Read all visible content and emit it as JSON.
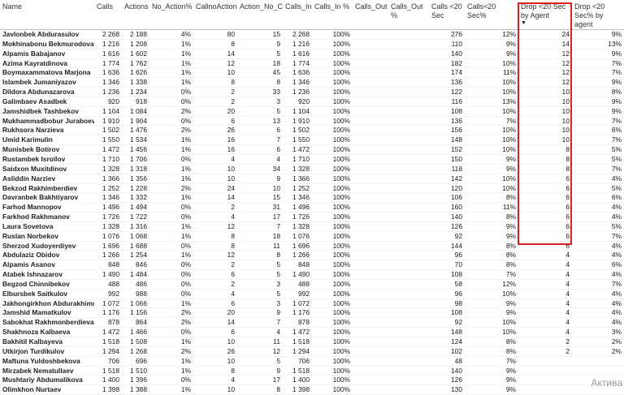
{
  "columns": [
    "Name",
    "Calls",
    "Actions",
    "No_Action%",
    "CallnoAction",
    "Action_No_Call",
    "Calls_In",
    "Calls_In %",
    "Calls_Out",
    "Calls_Out %",
    "Calls <20 Sec",
    "Calls<20 Sec%",
    "Drop <20 Sec by Agent",
    "Drop <20 Sec% by agent"
  ],
  "sort_indicator": "▼",
  "watermark": "Актива",
  "colors": {
    "highlight": "#e02020"
  },
  "rows": [
    [
      "Javlonbek Abdurasulov",
      "2 268",
      "2 188",
      "4%",
      "80",
      "15",
      "2 268",
      "100%",
      "",
      "",
      "276",
      "12%",
      "24",
      "9%"
    ],
    [
      "Mokhinabonu Bekmurodova",
      "1 216",
      "1 208",
      "1%",
      "8",
      "9",
      "1 216",
      "100%",
      "",
      "",
      "110",
      "9%",
      "14",
      "13%"
    ],
    [
      "Alpamis Babajanov",
      "1 616",
      "1 602",
      "1%",
      "14",
      "5",
      "1 616",
      "100%",
      "",
      "",
      "140",
      "9%",
      "12",
      "9%"
    ],
    [
      "Azima Kayratdinova",
      "1 774",
      "1 762",
      "1%",
      "12",
      "18",
      "1 774",
      "100%",
      "",
      "",
      "182",
      "10%",
      "12",
      "7%"
    ],
    [
      "Boymaxammatova Marjona",
      "1 636",
      "1 626",
      "1%",
      "10",
      "45",
      "1 636",
      "100%",
      "",
      "",
      "174",
      "11%",
      "12",
      "7%"
    ],
    [
      "Islambek Jumaniyazov",
      "1 346",
      "1 338",
      "1%",
      "8",
      "8",
      "1 346",
      "100%",
      "",
      "",
      "136",
      "10%",
      "12",
      "9%"
    ],
    [
      "Dildora Abdunazarova",
      "1 236",
      "1 234",
      "0%",
      "2",
      "33",
      "1 236",
      "100%",
      "",
      "",
      "122",
      "10%",
      "10",
      "8%"
    ],
    [
      "Galimbaev Asadbek",
      "920",
      "918",
      "0%",
      "2",
      "3",
      "920",
      "100%",
      "",
      "",
      "116",
      "13%",
      "10",
      "9%"
    ],
    [
      "Jamshidbek Tashbekov",
      "1 104",
      "1 084",
      "2%",
      "20",
      "5",
      "1 104",
      "100%",
      "",
      "",
      "108",
      "10%",
      "10",
      "9%"
    ],
    [
      "Mukhammadbobur Juraboev",
      "1 910",
      "1 904",
      "0%",
      "6",
      "13",
      "1 910",
      "100%",
      "",
      "",
      "136",
      "7%",
      "10",
      "7%"
    ],
    [
      "Rukhsora Narzieva",
      "1 502",
      "1 476",
      "2%",
      "26",
      "6",
      "1 502",
      "100%",
      "",
      "",
      "156",
      "10%",
      "10",
      "6%"
    ],
    [
      "Umid Karimulin",
      "1 550",
      "1 534",
      "1%",
      "16",
      "7",
      "1 550",
      "100%",
      "",
      "",
      "148",
      "10%",
      "10",
      "7%"
    ],
    [
      "Munisbek Botirov",
      "1 472",
      "1 456",
      "1%",
      "16",
      "6",
      "1 472",
      "100%",
      "",
      "",
      "152",
      "10%",
      "8",
      "5%"
    ],
    [
      "Rustambek Isroilov",
      "1 710",
      "1 706",
      "0%",
      "4",
      "4",
      "1 710",
      "100%",
      "",
      "",
      "150",
      "9%",
      "8",
      "5%"
    ],
    [
      "Saidxon Muxitdinov",
      "1 328",
      "1 318",
      "1%",
      "10",
      "34",
      "1 328",
      "100%",
      "",
      "",
      "118",
      "9%",
      "8",
      "7%"
    ],
    [
      "Asliddin Narziev",
      "1 366",
      "1 356",
      "1%",
      "10",
      "9",
      "1 366",
      "100%",
      "",
      "",
      "142",
      "10%",
      "6",
      "4%"
    ],
    [
      "Bekzod Rakhimberdiev",
      "1 252",
      "1 228",
      "2%",
      "24",
      "10",
      "1 252",
      "100%",
      "",
      "",
      "120",
      "10%",
      "6",
      "5%"
    ],
    [
      "Davranbek Bakhtiyarov",
      "1 346",
      "1 332",
      "1%",
      "14",
      "15",
      "1 346",
      "100%",
      "",
      "",
      "106",
      "8%",
      "6",
      "6%"
    ],
    [
      "Farhod Mannopov",
      "1 496",
      "1 494",
      "0%",
      "2",
      "31",
      "1 496",
      "100%",
      "",
      "",
      "160",
      "11%",
      "6",
      "4%"
    ],
    [
      "Farkhod Rakhmanov",
      "1 726",
      "1 722",
      "0%",
      "4",
      "17",
      "1 726",
      "100%",
      "",
      "",
      "140",
      "8%",
      "6",
      "4%"
    ],
    [
      "Laura Sovetova",
      "1 328",
      "1 316",
      "1%",
      "12",
      "7",
      "1 328",
      "100%",
      "",
      "",
      "126",
      "9%",
      "6",
      "5%"
    ],
    [
      "Ruslan Norbekov",
      "1 076",
      "1 068",
      "1%",
      "8",
      "18",
      "1 076",
      "100%",
      "",
      "",
      "92",
      "9%",
      "6",
      "7%"
    ],
    [
      "Sherzod Xudoyerdiyev",
      "1 696",
      "1 688",
      "0%",
      "8",
      "11",
      "1 696",
      "100%",
      "",
      "",
      "144",
      "8%",
      "6",
      "4%"
    ],
    [
      "Abdulaziz Obidov",
      "1 266",
      "1 254",
      "1%",
      "12",
      "8",
      "1 266",
      "100%",
      "",
      "",
      "96",
      "8%",
      "4",
      "4%"
    ],
    [
      "Alpamis Asanov",
      "848",
      "846",
      "0%",
      "2",
      "5",
      "848",
      "100%",
      "",
      "",
      "70",
      "8%",
      "4",
      "6%"
    ],
    [
      "Atabek Ishnazarov",
      "1 490",
      "1 484",
      "0%",
      "6",
      "5",
      "1 490",
      "100%",
      "",
      "",
      "108",
      "7%",
      "4",
      "4%"
    ],
    [
      "Begzod Chinnibekov",
      "488",
      "486",
      "0%",
      "2",
      "3",
      "488",
      "100%",
      "",
      "",
      "58",
      "12%",
      "4",
      "7%"
    ],
    [
      "Elbursbek Saitkulov",
      "992",
      "988",
      "0%",
      "4",
      "5",
      "992",
      "100%",
      "",
      "",
      "96",
      "10%",
      "4",
      "4%"
    ],
    [
      "Jakhongirkhon Abdurakhimov",
      "1 072",
      "1 066",
      "1%",
      "6",
      "3",
      "1 072",
      "100%",
      "",
      "",
      "98",
      "9%",
      "4",
      "4%"
    ],
    [
      "Jamshid Mamatkulov",
      "1 176",
      "1 156",
      "2%",
      "20",
      "9",
      "1 176",
      "100%",
      "",
      "",
      "108",
      "9%",
      "4",
      "4%"
    ],
    [
      "Sabokhat Rakhmonberdieva",
      "878",
      "864",
      "2%",
      "14",
      "7",
      "878",
      "100%",
      "",
      "",
      "92",
      "10%",
      "4",
      "4%"
    ],
    [
      "Shakhnoza Kalbaeva",
      "1 472",
      "1 466",
      "0%",
      "6",
      "4",
      "1 472",
      "100%",
      "",
      "",
      "148",
      "10%",
      "4",
      "3%"
    ],
    [
      "Bakhitil Kalbayeva",
      "1 518",
      "1 508",
      "1%",
      "10",
      "11",
      "1 518",
      "100%",
      "",
      "",
      "124",
      "8%",
      "2",
      "2%"
    ],
    [
      "Utkirjon Turdikulov",
      "1 294",
      "1 268",
      "2%",
      "26",
      "12",
      "1 294",
      "100%",
      "",
      "",
      "102",
      "8%",
      "2",
      "2%"
    ],
    [
      "Maftuna Yuldoshbekova",
      "706",
      "696",
      "1%",
      "10",
      "5",
      "706",
      "100%",
      "",
      "",
      "48",
      "7%",
      "",
      ""
    ],
    [
      "Mirzabek Nematullaev",
      "1 518",
      "1 510",
      "1%",
      "8",
      "9",
      "1 518",
      "100%",
      "",
      "",
      "140",
      "9%",
      "",
      ""
    ],
    [
      "Mushtariy Abdumalikova",
      "1 400",
      "1 396",
      "0%",
      "4",
      "17",
      "1 400",
      "100%",
      "",
      "",
      "126",
      "9%",
      "",
      ""
    ],
    [
      "Olimkhon Nurtaev",
      "1 398",
      "1 388",
      "1%",
      "10",
      "8",
      "1 398",
      "100%",
      "",
      "",
      "130",
      "9%",
      "",
      ""
    ]
  ]
}
